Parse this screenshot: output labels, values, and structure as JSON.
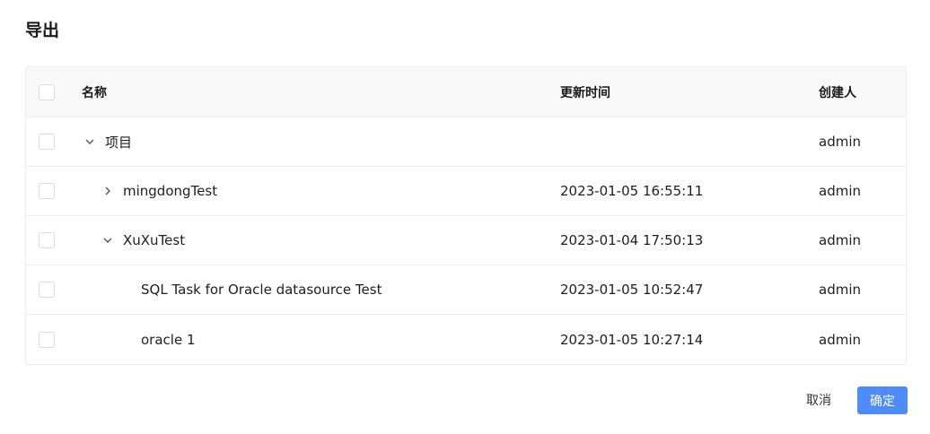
{
  "dialog": {
    "title": "导出"
  },
  "table": {
    "headers": {
      "name": "名称",
      "time": "更新时间",
      "creator": "创建人"
    },
    "rows": [
      {
        "name": "项目",
        "time": "",
        "creator": "admin",
        "level": 0,
        "expand": "expanded"
      },
      {
        "name": "mingdongTest",
        "time": "2023-01-05 16:55:11",
        "creator": "admin",
        "level": 1,
        "expand": "collapsed"
      },
      {
        "name": "XuXuTest",
        "time": "2023-01-04 17:50:13",
        "creator": "admin",
        "level": 1,
        "expand": "expanded"
      },
      {
        "name": "SQL Task for Oracle datasource Test",
        "time": "2023-01-05 10:52:47",
        "creator": "admin",
        "level": 2,
        "expand": "leaf"
      },
      {
        "name": "oracle 1",
        "time": "2023-01-05 10:27:14",
        "creator": "admin",
        "level": 2,
        "expand": "leaf"
      }
    ]
  },
  "footer": {
    "cancel_label": "取消",
    "ok_label": "确定"
  },
  "colors": {
    "primary": "#4e8cf7",
    "border": "#eeeeee",
    "header_bg": "#f8f8f9"
  }
}
